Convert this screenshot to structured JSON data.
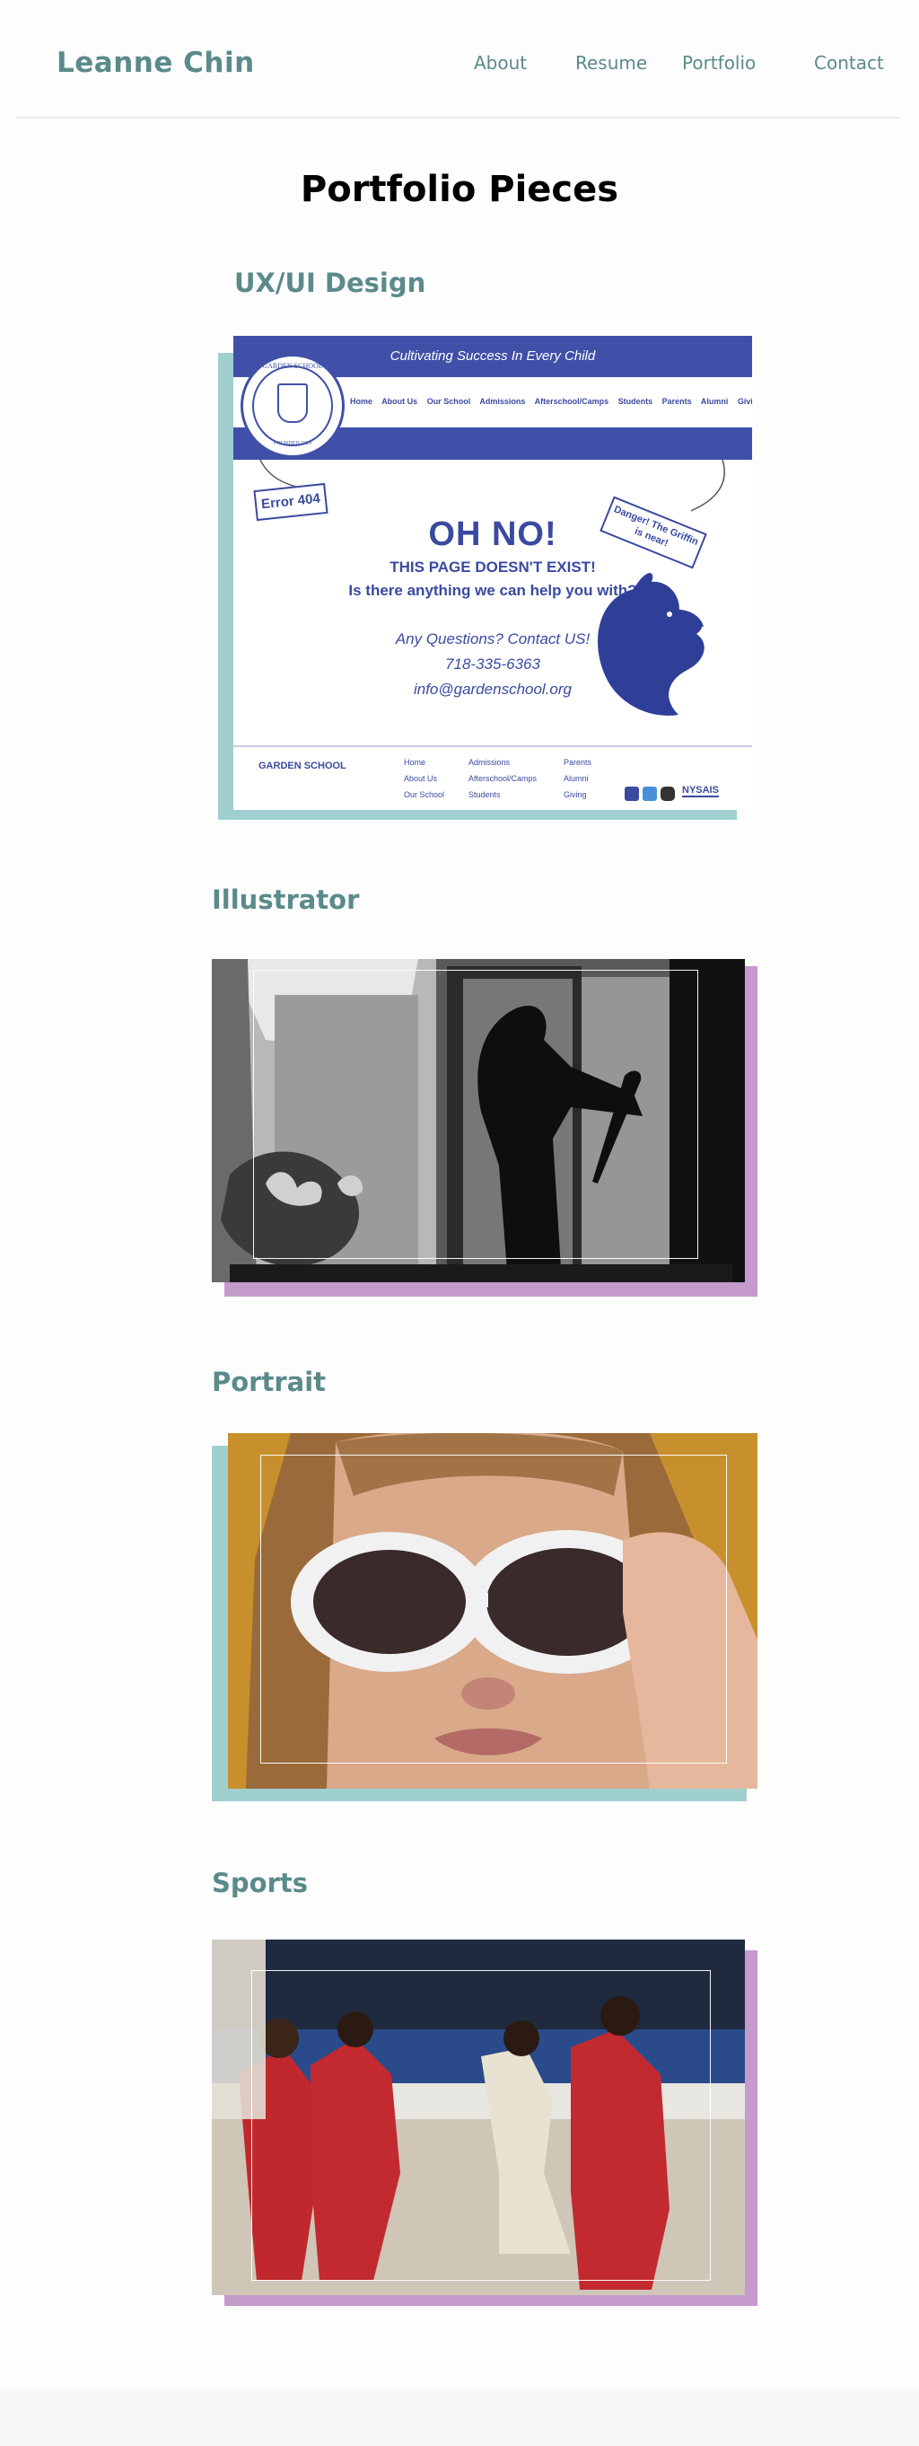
{
  "site": {
    "brand": "Leanne Chin"
  },
  "nav": {
    "items": [
      {
        "label": "About"
      },
      {
        "label": "Resume"
      },
      {
        "label": "Portfolio"
      },
      {
        "label": "Contact"
      }
    ]
  },
  "page": {
    "title": "Portfolio Pieces"
  },
  "sections": [
    {
      "title": "UX/UI Design",
      "shadow_color": "#9fcfcf"
    },
    {
      "title": "Illustrator",
      "shadow_color": "#c49bcb"
    },
    {
      "title": "Portrait",
      "shadow_color": "#9fcfcf"
    },
    {
      "title": "Sports",
      "shadow_color": "#c49bcb"
    }
  ],
  "ux_mockup": {
    "tagline": "Cultivating Success In Every Child",
    "seal_text": "GARDEN SCHOOL",
    "seal_founded": "FOUNDED 1923",
    "nav": [
      "Home",
      "About Us",
      "Our School",
      "Admissions",
      "Afterschool/Camps",
      "Students",
      "Parents",
      "Alumni",
      "Giving"
    ],
    "error_tag": "Error 404",
    "danger_tag": "Danger! The Griffin is near!",
    "headline": "OH NO!",
    "line1": "THIS PAGE DOESN'T EXIST!",
    "line2": "Is there anything we can help you with?",
    "contact1": "Any Questions? Contact US!",
    "contact2": "718-335-6363",
    "contact3": "info@gardenschool.org",
    "footer_school": "GARDEN SCHOOL",
    "footer_col1": [
      "Home",
      "About Us",
      "Our School"
    ],
    "footer_col2": [
      "Admissions",
      "Afterschool/Camps",
      "Students"
    ],
    "footer_col3": [
      "Parents",
      "Alumni",
      "Giving"
    ],
    "footer_badge": "NYSAIS"
  },
  "colors": {
    "brand_teal": "#5b8a8a",
    "teal_shadow": "#9fcfcf",
    "purple_shadow": "#c49bcb",
    "mockup_blue": "#4050a8"
  }
}
